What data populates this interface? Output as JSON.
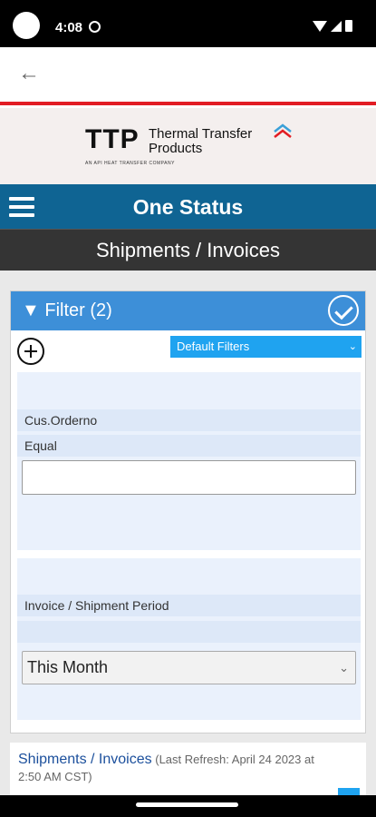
{
  "status_bar": {
    "time": "4:08"
  },
  "logo": {
    "abbrev": "TTP",
    "name_line1": "Thermal Transfer",
    "name_line2": "Products",
    "tagline": "AN API HEAT TRANSFER COMPANY"
  },
  "header": {
    "title": "One Status"
  },
  "subheader": {
    "title": "Shipments / Invoices"
  },
  "filter": {
    "title": "▼ Filter (2)",
    "default_filters": "Default Filters",
    "field1": {
      "name": "Cus.Orderno",
      "operator": "Equal",
      "value": ""
    },
    "field2": {
      "name": "Invoice / Shipment Period",
      "operator": "",
      "selected": "This Month"
    }
  },
  "results": {
    "title": "Shipments / Invoices",
    "refresh_line1": " (Last Refresh: April 24 2023 at",
    "refresh_line2": "2:50 AM CST)"
  },
  "colors": {
    "header_blue": "#0f6493",
    "filter_blue": "#3d8fd8",
    "select_blue": "#1fa3f0",
    "accent_red": "#e21d24"
  }
}
